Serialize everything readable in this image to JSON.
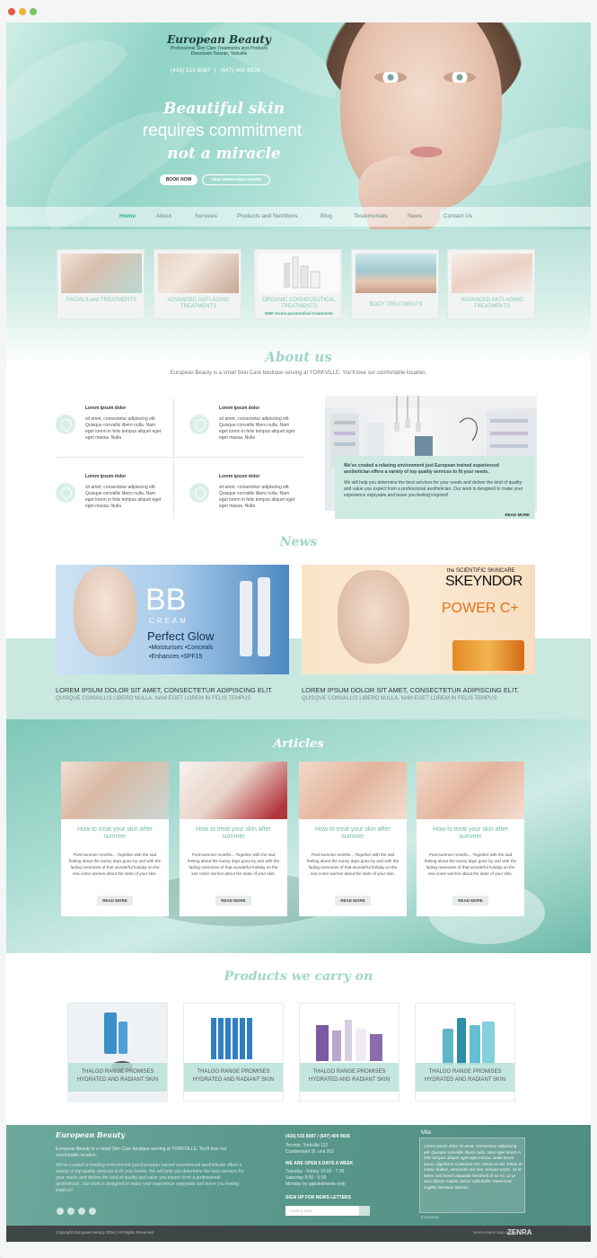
{
  "colors": {
    "accent": "#9fd6ca",
    "accent_dark": "#3fa88e",
    "footer": "#5a998c",
    "window_dots": [
      "#e25a4b",
      "#f0b03a",
      "#7cc15f"
    ]
  },
  "hero": {
    "logo_title": "European Beauty",
    "logo_sub1": "Professional Skin Care Treatments and Products",
    "logo_sub2": "Downtown Toronto, Yorkville",
    "phone1": "(416) 515 8087",
    "phone2": "(647) 400 9926",
    "line1": "Beautiful skin",
    "line2": "requires commitment",
    "line3": "not a miracle",
    "book_btn": "BOOK NOW",
    "hours_btn": "VIEW OPERATING HOURS"
  },
  "nav": {
    "items": [
      "Home",
      "About",
      "Services",
      "Products and Nutritions",
      "Blog",
      "Testemonials",
      "News",
      "Contact Us"
    ]
  },
  "services": [
    {
      "label": "FACIALS and TREATMENTS",
      "sub": ""
    },
    {
      "label": "ADVANCED ANTI-AGING TREATMENTS",
      "sub": ""
    },
    {
      "label": "ORGANIC COSMECEUTICAL TREATMENTS",
      "sub": "DMK Dome paramedical treatments"
    },
    {
      "label": "BODY TREATMENTS",
      "sub": ""
    },
    {
      "label": "ADVANCED ANTI-AGING TREATMENTS",
      "sub": ""
    }
  ],
  "about": {
    "title": "About us",
    "intro": "European Beauty is a small Skin Care boutique serving at YORKVILLE. You'll love our comfortable location.",
    "features": [
      {
        "heading": "Lorem ipsum dolor",
        "text": "sit amet, consectetur adipiscing elit. Quisque convallis libero nulla. Nam eget lorem in felis tempus aliquet eget eget massa. Nulla"
      },
      {
        "heading": "Lorem ipsum dolor",
        "text": "sit amet, consectetur adipiscing elit. Quisque convallis libero nulla. Nam eget lorem in felis tempus aliquet eget eget massa. Nulla"
      },
      {
        "heading": "Lorem ipsum dolor",
        "text": "sit amet, consectetur adipiscing elit. Quisque convallis libero nulla. Nam eget lorem in felis tempus aliquet eget eget massa. Nulla"
      },
      {
        "heading": "Lorem ipsum dolor",
        "text": "sit amet, consectetur adipiscing elit. Quisque convallis libero nulla. Nam eget lorem in felis tempus aliquet eget eget massa. Nulla"
      }
    ],
    "box_p1": "We've created a relaxing environment just European trained experienced aesthetician offers a variety of top quality services to fit your needs.",
    "box_p2": "We will help you determine the best services for your needs and deliver the kind of quality and value you expect from a professional aesthetician. Our work is designed to make your experience enjoyable and leave you feeling inspired!",
    "read_more": "READ MORE"
  },
  "news": {
    "title": "News",
    "items": [
      {
        "headline": "LOREM IPSUM DOLOR SIT AMET, CONSECTETUR ADIPISCING ELIT.",
        "sub": "QUISQUE CONVALLIS LIBERO NULLA. NAM EGET LOREM IN FELIS TEMPUS",
        "ad_big": "BB",
        "ad_cream": "CREAM",
        "ad_glow": "Perfect Glow",
        "ad_b1": "•Moisturises •Conceals",
        "ad_b2": "•Enhances •SPF15"
      },
      {
        "headline": "LOREM IPSUM DOLOR SIT AMET, CONSECTETUR ADIPISCING ELIT.",
        "sub": "QUISQUE CONVALLIS LIBERO NULLA. NAM EGET LOREM IN FELIS TEMPUS",
        "ad_brand_small": "the SCIENTIFIC SKINCARE",
        "ad_brand": "SKEYNDOR",
        "ad_power": "POWER C+"
      }
    ]
  },
  "articles": {
    "title": "Articles",
    "items": [
      {
        "heading": "How to treat your skin after summer",
        "text": "Post-summer months... Together with the sad feeling about the sunny days gone by and with the fading memories of that wonderful holiday on the sea come worries about the state of your skin.",
        "more": "READ MORE"
      },
      {
        "heading": "How to treat your skin after summer",
        "text": "Post-summer months... Together with the sad feeling about the sunny days gone by and with the fading memories of that wonderful holiday on the sea come worries about the state of your skin.",
        "more": "READ MORE"
      },
      {
        "heading": "How to treat your skin after summer",
        "text": "Post-summer months... Together with the sad feeling about the sunny days gone by and with the fading memories of that wonderful holiday on the sea come worries about the state of your skin.",
        "more": "READ MORE"
      },
      {
        "heading": "How to treat your skin after summer",
        "text": "Post-summer months... Together with the sad feeling about the sunny days gone by and with the fading memories of that wonderful holiday on the sea come worries about the state of your skin.",
        "more": "READ MORE"
      }
    ]
  },
  "products": {
    "title": "Products we carry on",
    "items": [
      {
        "line1": "THALGO RANGE PROMISES",
        "line2": "HYDRATED AND RADIANT SKIN"
      },
      {
        "line1": "THALGO RANGE PROMISES",
        "line2": "HYDRATED AND RADIANT SKIN"
      },
      {
        "line1": "THALGO RANGE PROMISES",
        "line2": "HYDRATED AND RADIANT SKIN"
      },
      {
        "line1": "THALGO RANGE PROMISES",
        "line2": "HYDRATED AND RADIANT SKIN"
      }
    ]
  },
  "footer": {
    "logo": "European Beauty",
    "p1": "European Beauty is a small Skin Care boutique serving at YORKVILLE. You'll love our comfortable location.",
    "p2": "We've created a relaxing environment just European trained experienced aesthetician offers a variety of top quality services to fit your needs. We will help you determine the best services for your needs and deliver the kind of quality and value you expect from a professional aesthetician. Our work is designed to make your experience enjoyable and leave you feeling inspired!",
    "phones": "(416) 515 8087  /  (647) 400 9926",
    "addr1": "Toronto, Yorkville 112",
    "addr2": "Cumberland St. unit 202",
    "open_title": "WE ARE OPEN 6 DAYS A WEEK",
    "hours1": "Tuesday - Friday 10:00 - 7:30",
    "hours2": "Saturday 9:00 - 6:00",
    "hours3": "Monday by appointments only",
    "signup": "SIGN UP FOR NEWS LETTERS",
    "email_placeholder": "YOUR E-MAIL",
    "testi_name": "Mila",
    "testi_text": "Lorem ipsum dolor sit amet, consectetur adipiscing elit. Quisque convallis libero nulla. Nam eget lorem in felis tempus aliquet eget eget massa. Nulla lorem purus, dignissim a placerat vel, rutrum at dui. Etiam et metus finibus, venenatis nisl nec, tempus turpis. Ut et lorem sed lorem vulputate hendrerit id eu mi. Ut ut arcu dictum sapien varius sollicitudin. Maecenas sagittis interdum lobortis.",
    "testi_date": "27/04/2016",
    "copyright": "Copyright European beauty 2016  |  All Rights Reserved",
    "dev": "DEVELOPMENT AND DESIGN",
    "dev_brand": "ZENRA"
  }
}
